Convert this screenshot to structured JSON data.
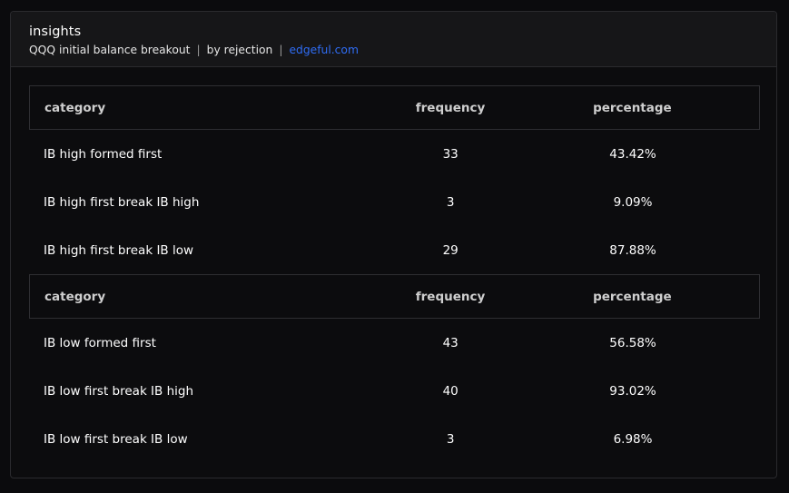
{
  "card": {
    "title": "insights",
    "subtitle": {
      "ticker_desc": "QQQ initial balance breakout",
      "separator": "|",
      "by": "by rejection",
      "link": "edgeful.com"
    }
  },
  "tables": [
    {
      "headers": {
        "category": "category",
        "frequency": "frequency",
        "percentage": "percentage"
      },
      "rows": [
        {
          "category": "IB high formed first",
          "frequency": "33",
          "percentage": "43.42%"
        },
        {
          "category": "IB high first break IB high",
          "frequency": "3",
          "percentage": "9.09%"
        },
        {
          "category": "IB high first break IB low",
          "frequency": "29",
          "percentage": "87.88%"
        }
      ]
    },
    {
      "headers": {
        "category": "category",
        "frequency": "frequency",
        "percentage": "percentage"
      },
      "rows": [
        {
          "category": "IB low formed first",
          "frequency": "43",
          "percentage": "56.58%"
        },
        {
          "category": "IB low first break IB high",
          "frequency": "40",
          "percentage": "93.02%"
        },
        {
          "category": "IB low first break IB low",
          "frequency": "3",
          "percentage": "6.98%"
        }
      ]
    }
  ]
}
